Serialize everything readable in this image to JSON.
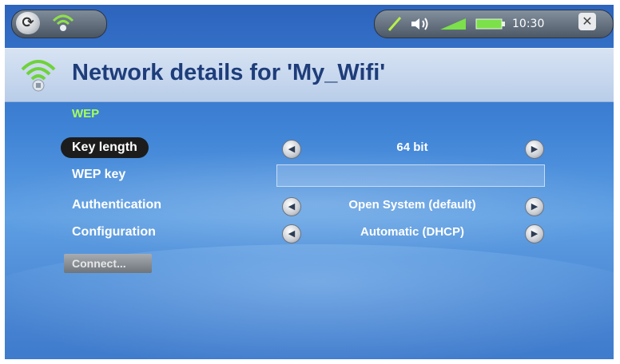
{
  "status_bar": {
    "refresh_icon_glyph": "⟳",
    "time": "10:30",
    "close_glyph": "✕"
  },
  "header": {
    "title": "Network details for 'My_Wifi'"
  },
  "section": {
    "label": "WEP"
  },
  "settings": [
    {
      "label": "Key length",
      "value": "64 bit",
      "selected": true
    },
    {
      "label": "WEP key",
      "value": "",
      "placeholder": ""
    },
    {
      "label": "Authentication",
      "value": "Open System (default)"
    },
    {
      "label": "Configuration",
      "value": "Automatic (DHCP)"
    }
  ],
  "actions": {
    "connect_label": "Connect..."
  },
  "colors": {
    "section_label": "#a6ff5a",
    "title": "#1e3d7a",
    "background": "#3f83d6"
  }
}
